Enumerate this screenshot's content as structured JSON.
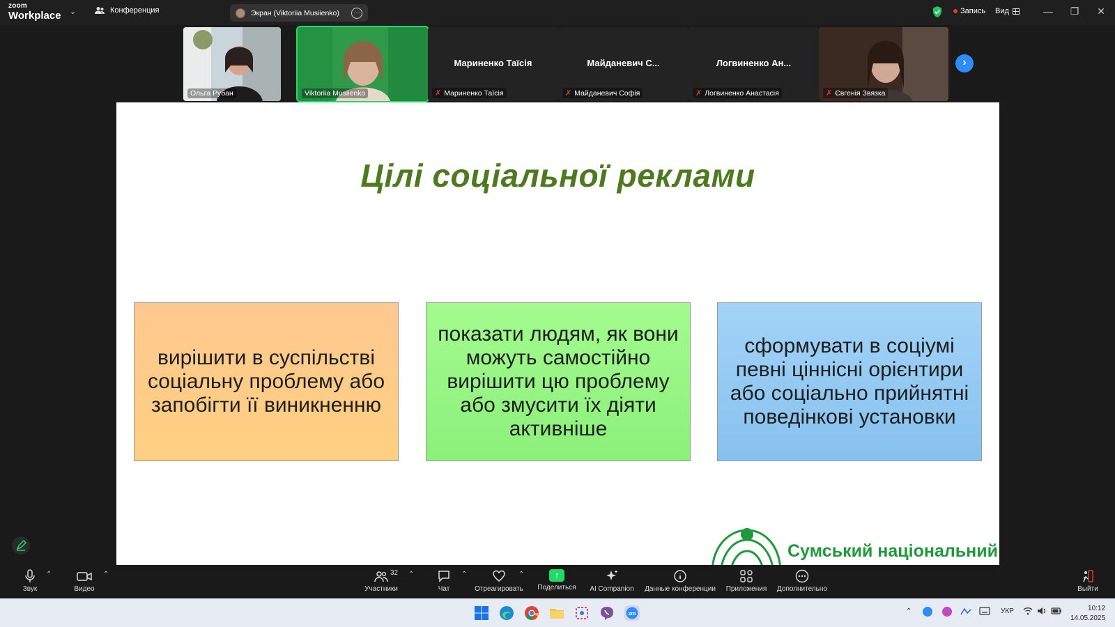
{
  "app": {
    "brand_top": "zoom",
    "brand_bottom": "Workplace",
    "conference_label": "Конференция"
  },
  "share_pill": {
    "label": "Экран (Viktoriia Musiienko)"
  },
  "header_right": {
    "record_label": "Запись",
    "view_label": "Вид"
  },
  "participants": [
    {
      "name": "Ольга Рубан",
      "big_name": ""
    },
    {
      "name": "Viktoriia Musiienko",
      "big_name": ""
    },
    {
      "name": "Мариненко Таїсія",
      "big_name": "Мариненко  Таїсія"
    },
    {
      "name": "Майданевич Софія",
      "big_name": "Майданевич  С..."
    },
    {
      "name": "Логвиненко Анастасія",
      "big_name": "Логвиненко  Ан..."
    },
    {
      "name": "Євгенія Звязка",
      "big_name": ""
    }
  ],
  "slide": {
    "title": "Цілі соціальної реклами",
    "boxes": [
      {
        "text": "вирішити в суспільстві соціальну проблему або запобігти її виникненню"
      },
      {
        "text": "показати людям, як вони можуть самостійно вирішити цю проблему або змусити їх діяти активніше"
      },
      {
        "text": "сформувати в соціумі певні ціннісні орієнтири або соціально прийнятні поведінкові установки"
      }
    ],
    "university": "Сумський національний"
  },
  "toolbar": {
    "audio": "Звук",
    "video": "Видео",
    "participants": "Участники",
    "participants_count": "32",
    "chat": "Чат",
    "react": "Отреагировать",
    "share": "Поделиться",
    "ai": "AI Companion",
    "info": "Данные конференции",
    "apps": "Приложения",
    "more": "Дополнительно",
    "leave": "Выйти"
  },
  "taskbar": {
    "lang": "УКР",
    "time": "10:12",
    "date": "14.05.2025"
  },
  "colors": {
    "title_green": "#4e7a1f",
    "uni_green": "#1f9a3a",
    "active_speaker": "#23d96b",
    "zoom_blue": "#2d8cff",
    "record_red": "#e23b3b"
  }
}
